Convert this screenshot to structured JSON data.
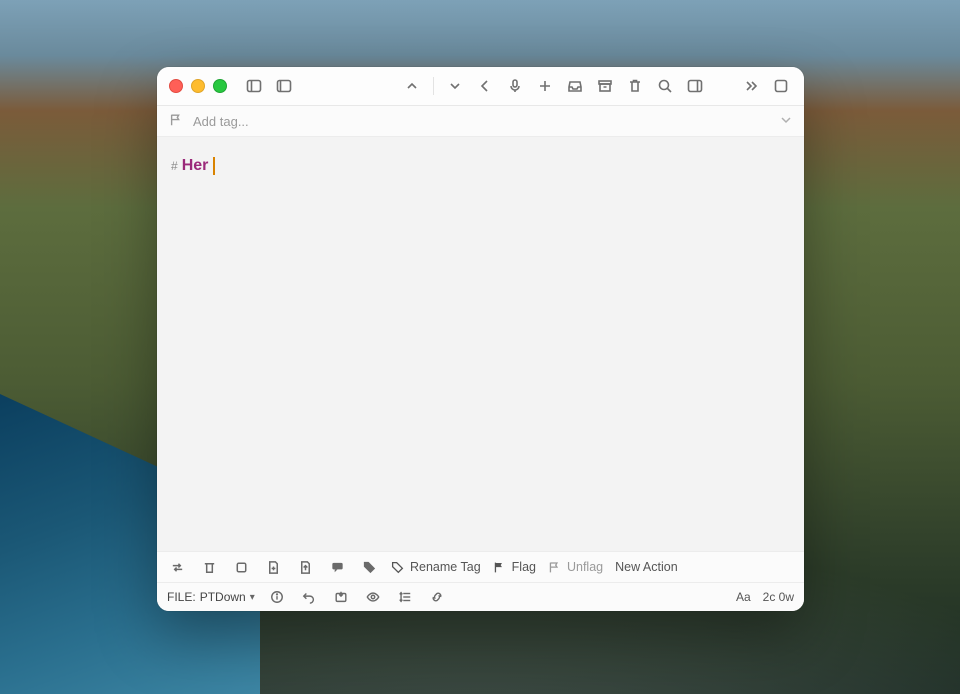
{
  "tagbar": {
    "placeholder": "Add tag..."
  },
  "editor": {
    "hash": "#",
    "heading": "Her"
  },
  "actions": {
    "rename_tag": "Rename Tag",
    "flag": "Flag",
    "unflag": "Unflag",
    "new_action": "New Action"
  },
  "status": {
    "file_label": "FILE:",
    "file_name": "PTDown",
    "aa": "Aa",
    "counts": "2c 0w"
  }
}
